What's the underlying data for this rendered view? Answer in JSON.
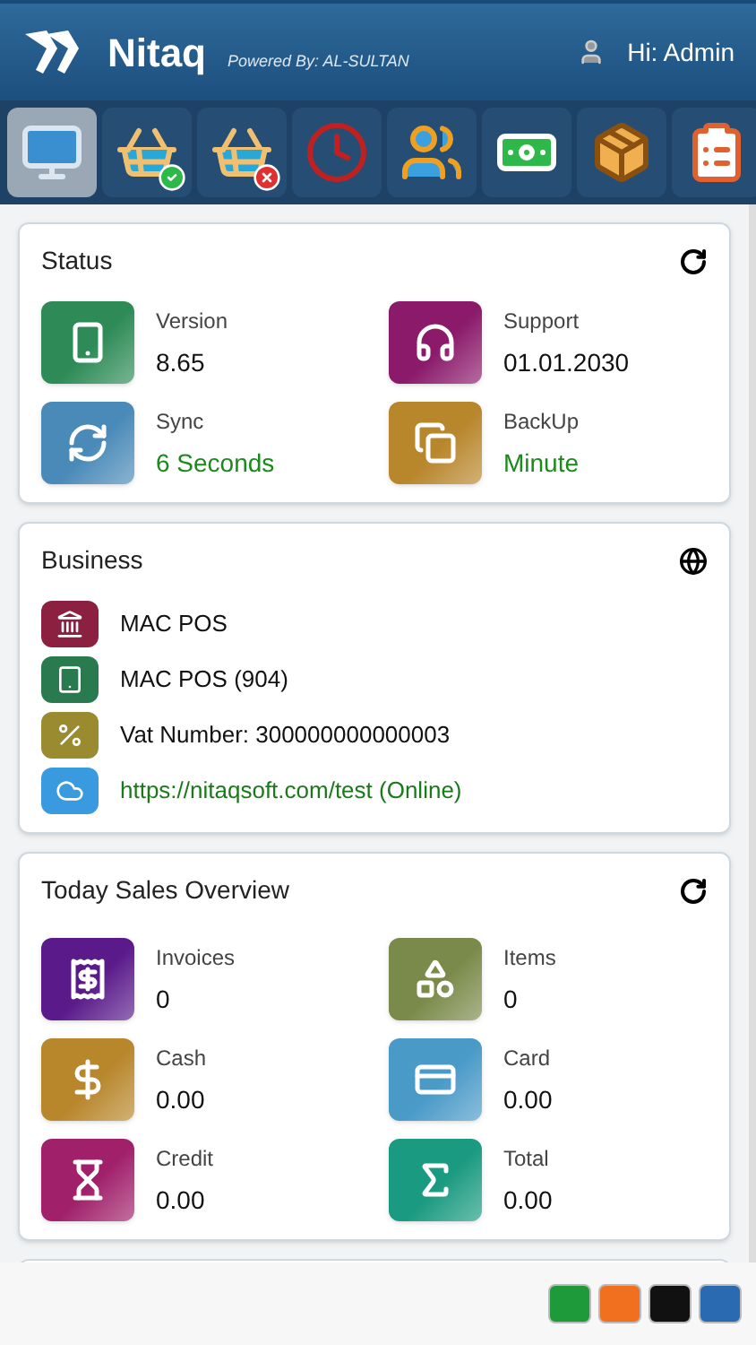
{
  "header": {
    "title": "Nitaq",
    "subtitle": "Powered By: AL-SULTAN",
    "greeting": "Hi: Admin"
  },
  "toolbar": [
    {
      "kind": "monitor",
      "selected": true
    },
    {
      "kind": "basket-ok",
      "selected": false
    },
    {
      "kind": "basket-cancel",
      "selected": false
    },
    {
      "kind": "clock",
      "selected": false
    },
    {
      "kind": "people",
      "selected": false
    },
    {
      "kind": "money",
      "selected": false
    },
    {
      "kind": "package",
      "selected": false
    },
    {
      "kind": "checklist",
      "selected": false
    }
  ],
  "status": {
    "title": "Status",
    "tiles": [
      {
        "kind": "version",
        "label": "Version",
        "value": "8.65",
        "color": "#2e8b57",
        "highlight": false
      },
      {
        "kind": "support",
        "label": "Support",
        "value": "01.01.2030",
        "color": "#8b1a6b",
        "highlight": false
      },
      {
        "kind": "sync",
        "label": "Sync",
        "value": "6 Seconds",
        "color": "#4a8ab8",
        "highlight": true
      },
      {
        "kind": "backup",
        "label": "BackUp",
        "value": "Minute",
        "color": "#b8862b",
        "highlight": true
      }
    ]
  },
  "business": {
    "title": "Business",
    "rows": [
      {
        "kind": "bank",
        "text": "MAC POS",
        "color": "#8b2040",
        "link": false
      },
      {
        "kind": "tablet",
        "text": "MAC POS (904)",
        "color": "#2a7a50",
        "link": false
      },
      {
        "kind": "percent",
        "text": "Vat Number: 300000000000003",
        "color": "#9a8a30",
        "link": false
      },
      {
        "kind": "cloud",
        "text": "https://nitaqsoft.com/test (Online)",
        "color": "#3a9ae0",
        "link": true
      }
    ]
  },
  "sales": {
    "title": "Today Sales Overview",
    "tiles": [
      {
        "kind": "invoices",
        "label": "Invoices",
        "value": "0",
        "color": "#5a1a8a",
        "highlight": false
      },
      {
        "kind": "items",
        "label": "Items",
        "value": "0",
        "color": "#7a8a4a",
        "highlight": false
      },
      {
        "kind": "cash",
        "label": "Cash",
        "value": "0.00",
        "color": "#b8862b",
        "highlight": false
      },
      {
        "kind": "card",
        "label": "Card",
        "value": "0.00",
        "color": "#4a9ac8",
        "highlight": false
      },
      {
        "kind": "credit",
        "label": "Credit",
        "value": "0.00",
        "color": "#a0206a",
        "highlight": false
      },
      {
        "kind": "total",
        "label": "Total",
        "value": "0.00",
        "color": "#1a9a80",
        "highlight": false
      }
    ]
  },
  "themes": [
    {
      "color": "#1e9a3a"
    },
    {
      "color": "#f07020"
    },
    {
      "color": "#111111"
    },
    {
      "color": "#2a6ab0"
    }
  ]
}
